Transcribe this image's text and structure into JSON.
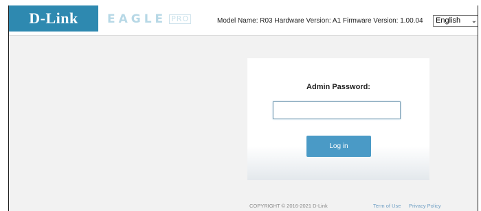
{
  "header": {
    "logo": "D-Link",
    "brand_name": "EAGLE",
    "brand_suffix": "PRO",
    "model_info": "Model Name: R03 Hardware Version: A1 Firmware Version: 1.00.04",
    "language": "English",
    "brand_color": "#2e89b0"
  },
  "login": {
    "password_label": "Admin Password:",
    "password_value": "",
    "login_button": "Log in",
    "button_color": "#4a9ac6"
  },
  "footer": {
    "copyright": "COPYRIGHT © 2016-2021 D-Link",
    "term_link": "Term of Use",
    "privacy_link": "Privacy Policy"
  }
}
